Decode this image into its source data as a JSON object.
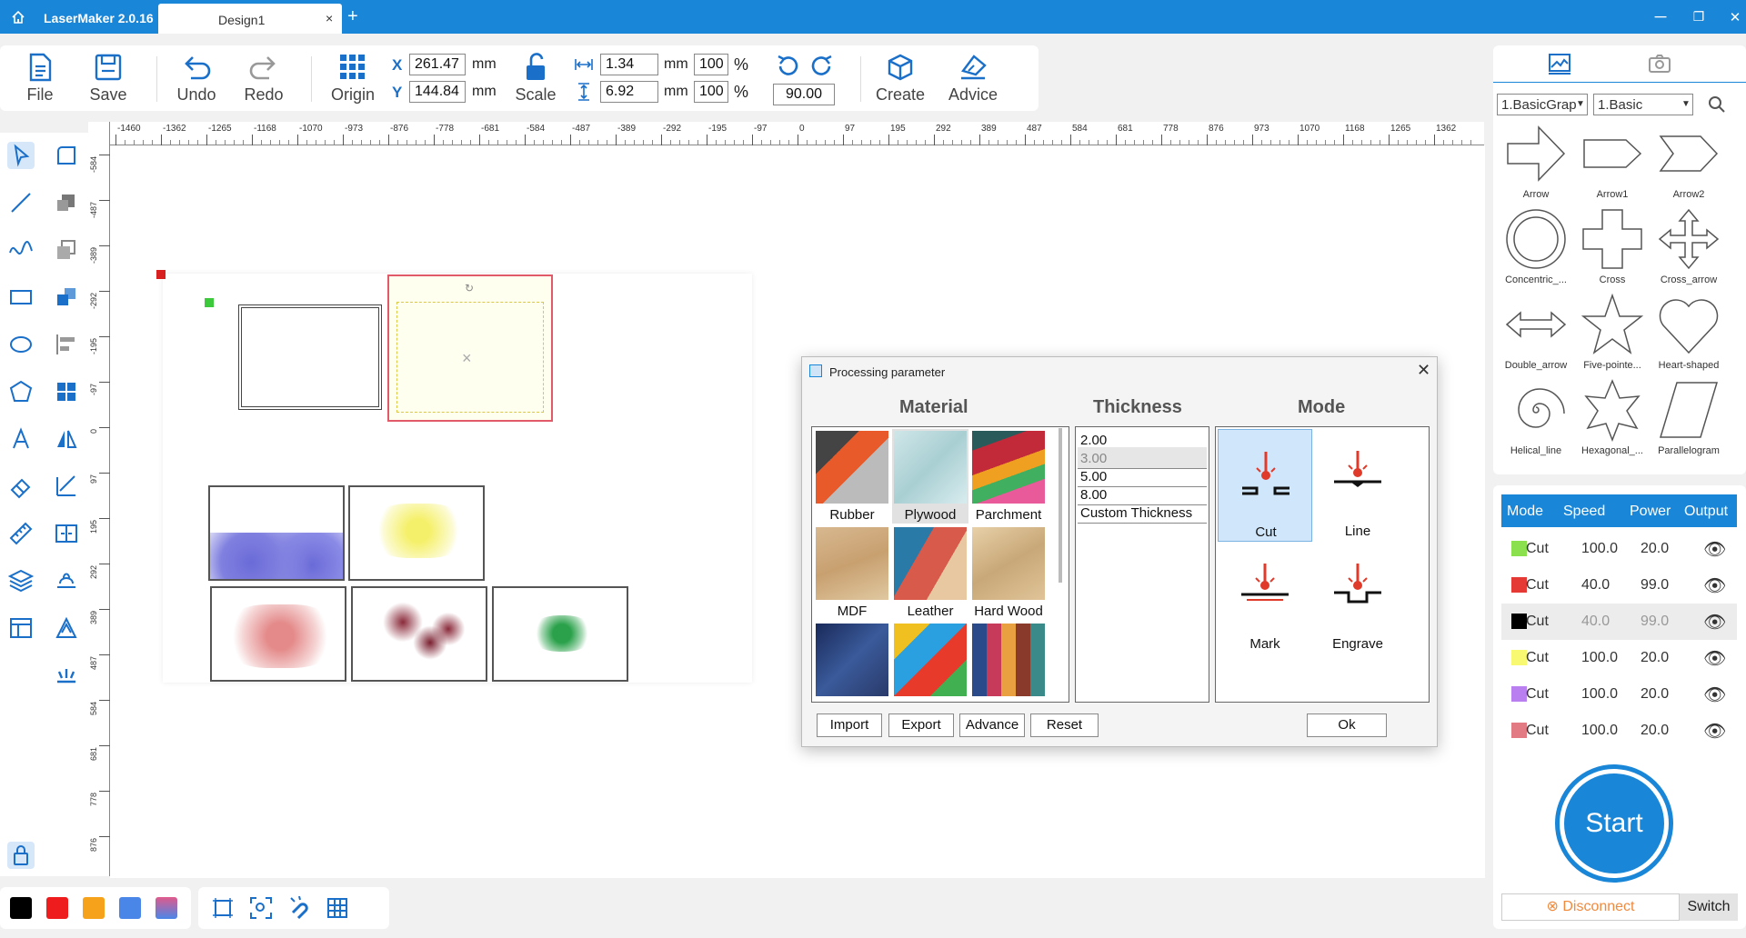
{
  "app": {
    "title": "LaserMaker 2.0.16",
    "tab": "Design1",
    "tab_close": "×",
    "new_tab": "+"
  },
  "window": {
    "minimize": "─",
    "maximize": "▫",
    "close": "✕"
  },
  "toolbar": {
    "file": "File",
    "save": "Save",
    "undo": "Undo",
    "redo": "Redo",
    "origin": "Origin",
    "scale": "Scale",
    "create": "Create",
    "advice": "Advice",
    "x_label": "X",
    "y_label": "Y",
    "x_value": "261.47",
    "y_value": "144.84",
    "width_value": "1.34",
    "height_value": "6.92",
    "width_pct": "100",
    "height_pct": "100",
    "unit": "mm",
    "pct": "%",
    "rotation": "90.00"
  },
  "ruler": {
    "unit": "mm",
    "top_ticks": [
      "-1460",
      "-1362",
      "-1265",
      "-1168",
      "-1070",
      "-973",
      "-876",
      "-778",
      "-681",
      "-584",
      "-487",
      "-389",
      "-292",
      "-195",
      "-97",
      "0",
      "97",
      "195",
      "292",
      "389",
      "487",
      "584",
      "681",
      "778",
      "876",
      "973",
      "1070",
      "1168",
      "1265",
      "1362"
    ],
    "left_ticks": [
      "-584",
      "-487",
      "-389",
      "-292",
      "-195",
      "-97",
      "0",
      "97",
      "195",
      "292",
      "389",
      "487",
      "584",
      "681",
      "778",
      "876"
    ]
  },
  "colors": {
    "accent": "#1a86d8",
    "swatches": [
      "#000000",
      "#ee1c1c",
      "#f6a21a",
      "#4a86e8",
      "#e05a8c"
    ]
  },
  "library": {
    "category": "1.BasicGrap",
    "subcategory": "1.Basic",
    "shapes": [
      "Arrow",
      "Arrow1",
      "Arrow2",
      "Concentric_...",
      "Cross",
      "Cross_arrow",
      "Double_arrow",
      "Five-pointe...",
      "Heart-shaped",
      "Helical_line",
      "Hexagonal_...",
      "Parallelogram"
    ]
  },
  "layers": {
    "headers": [
      "Mode",
      "Speed",
      "Power",
      "Output"
    ],
    "rows": [
      {
        "mode": "Cut",
        "speed": "100.0",
        "power": "20.0",
        "color": "#8be04e"
      },
      {
        "mode": "Cut",
        "speed": "40.0",
        "power": "99.0",
        "color": "#e53935"
      },
      {
        "mode": "Cut",
        "speed": "40.0",
        "power": "99.0",
        "color": "#000000"
      },
      {
        "mode": "Cut",
        "speed": "100.0",
        "power": "20.0",
        "color": "#f9f871"
      },
      {
        "mode": "Cut",
        "speed": "100.0",
        "power": "20.0",
        "color": "#b97ff0"
      },
      {
        "mode": "Cut",
        "speed": "100.0",
        "power": "20.0",
        "color": "#e27a84"
      }
    ]
  },
  "start": "Start",
  "disconnect": "Disconnect",
  "switch": "Switch",
  "dialog": {
    "title": "Processing parameter",
    "material_header": "Material",
    "thickness_header": "Thickness",
    "mode_header": "Mode",
    "materials": [
      "Rubber",
      "Plywood",
      "Parchment",
      "MDF",
      "Leather",
      "Hard Wood"
    ],
    "thickness": [
      "2.00",
      "3.00",
      "5.00",
      "8.00",
      "Custom Thickness"
    ],
    "modes": [
      "Cut",
      "Line",
      "Mark",
      "Engrave"
    ],
    "buttons": {
      "import": "Import",
      "export": "Export",
      "advance": "Advance",
      "reset": "Reset",
      "ok": "Ok"
    }
  }
}
